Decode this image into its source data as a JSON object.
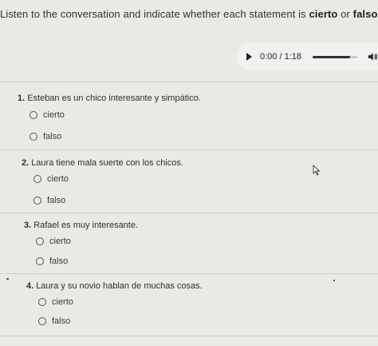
{
  "instructions": {
    "prefix": "Listen to the conversation and indicate whether each statement is ",
    "word1": "cierto",
    "middle": " or ",
    "word2": "falso",
    "suffix": "."
  },
  "audio": {
    "time": "0:00 / 1:18",
    "progress": 0.85
  },
  "questions": [
    {
      "number": "1.",
      "text": "Esteban es un chico interesante y simpático.",
      "options": [
        "cierto",
        "falso"
      ]
    },
    {
      "number": "2.",
      "text": "Laura tiene mala suerte con los chicos.",
      "options": [
        "cierto",
        "falso"
      ]
    },
    {
      "number": "3.",
      "text": "Rafael es muy interesante.",
      "options": [
        "cierto",
        "falso"
      ]
    },
    {
      "number": "4.",
      "text": "Laura y su novio hablan de muchas cosas.",
      "options": [
        "cierto",
        "falso"
      ]
    }
  ]
}
